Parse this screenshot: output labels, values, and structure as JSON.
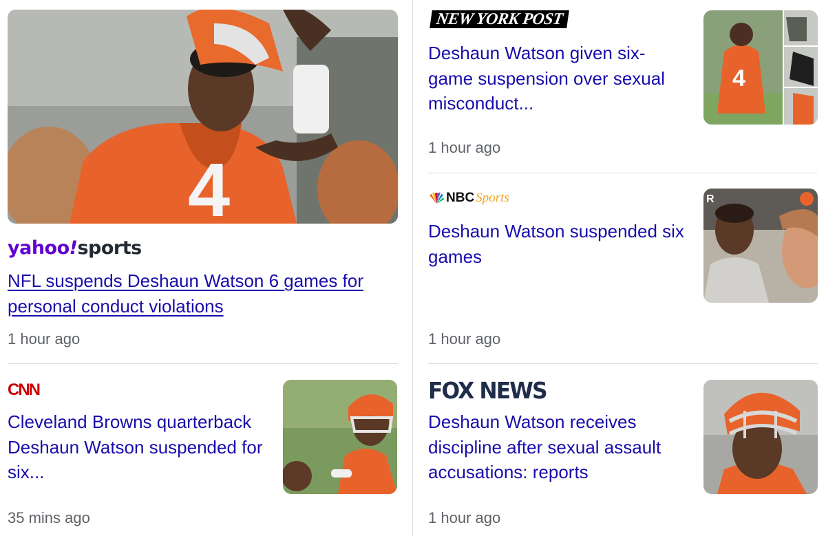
{
  "articles": [
    {
      "source": "yahoo!sports",
      "source_parts": [
        "yahoo",
        "!",
        "sports"
      ],
      "headline": "NFL suspends Deshaun Watson 6 games for personal conduct violations",
      "time": "1 hour ago",
      "underlined": true
    },
    {
      "source": "NEW YORK POST",
      "headline": "Deshaun Watson given six-game suspension over sexual misconduct...",
      "time": "1 hour ago"
    },
    {
      "source": "NBC Sports",
      "source_parts": [
        "NBC",
        "Sports"
      ],
      "headline": "Deshaun Watson suspended six games",
      "time": "1 hour ago"
    },
    {
      "source": "CNN",
      "headline": "Cleveland Browns quarterback Deshaun Watson suspended for six...",
      "time": "35 mins ago"
    },
    {
      "source": "FOX NEWS",
      "headline": "Deshaun Watson receives discipline after sexual assault accusations: reports",
      "time": "1 hour ago"
    }
  ],
  "colors": {
    "headline_link": "#1a0dab",
    "timestamp": "#5f6368",
    "divider": "#dadce0",
    "yahoo_purple": "#6001d2",
    "cnn_red": "#cc0000",
    "fox_navy": "#1f2d4a",
    "browns_orange": "#e8632b"
  }
}
